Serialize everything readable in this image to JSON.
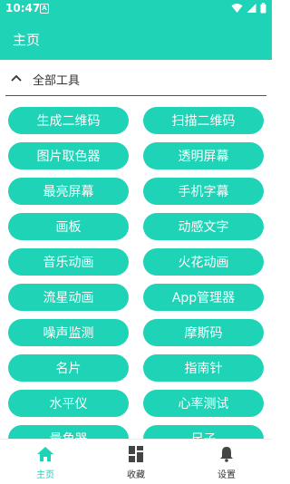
{
  "status_bar": {
    "time": "10:47",
    "sim_label": "A"
  },
  "app_bar": {
    "title": "主页"
  },
  "section": {
    "label": "全部工具"
  },
  "tools": [
    "生成二维码",
    "扫描二维码",
    "图片取色器",
    "透明屏幕",
    "最亮屏幕",
    "手机字幕",
    "画板",
    "动感文字",
    "音乐动画",
    "火花动画",
    "流星动画",
    "App管理器",
    "噪声监测",
    "摩斯码",
    "名片",
    "指南针",
    "水平仪",
    "心率测试",
    "量角器",
    "尺子"
  ],
  "bottom_nav": [
    {
      "label": "主页",
      "icon": "home-icon",
      "active": true
    },
    {
      "label": "收藏",
      "icon": "grid-icon",
      "active": false
    },
    {
      "label": "设置",
      "icon": "bell-icon",
      "active": false
    }
  ],
  "colors": {
    "accent": "#1ed3b6",
    "nav_active": "#1ed3b6"
  }
}
